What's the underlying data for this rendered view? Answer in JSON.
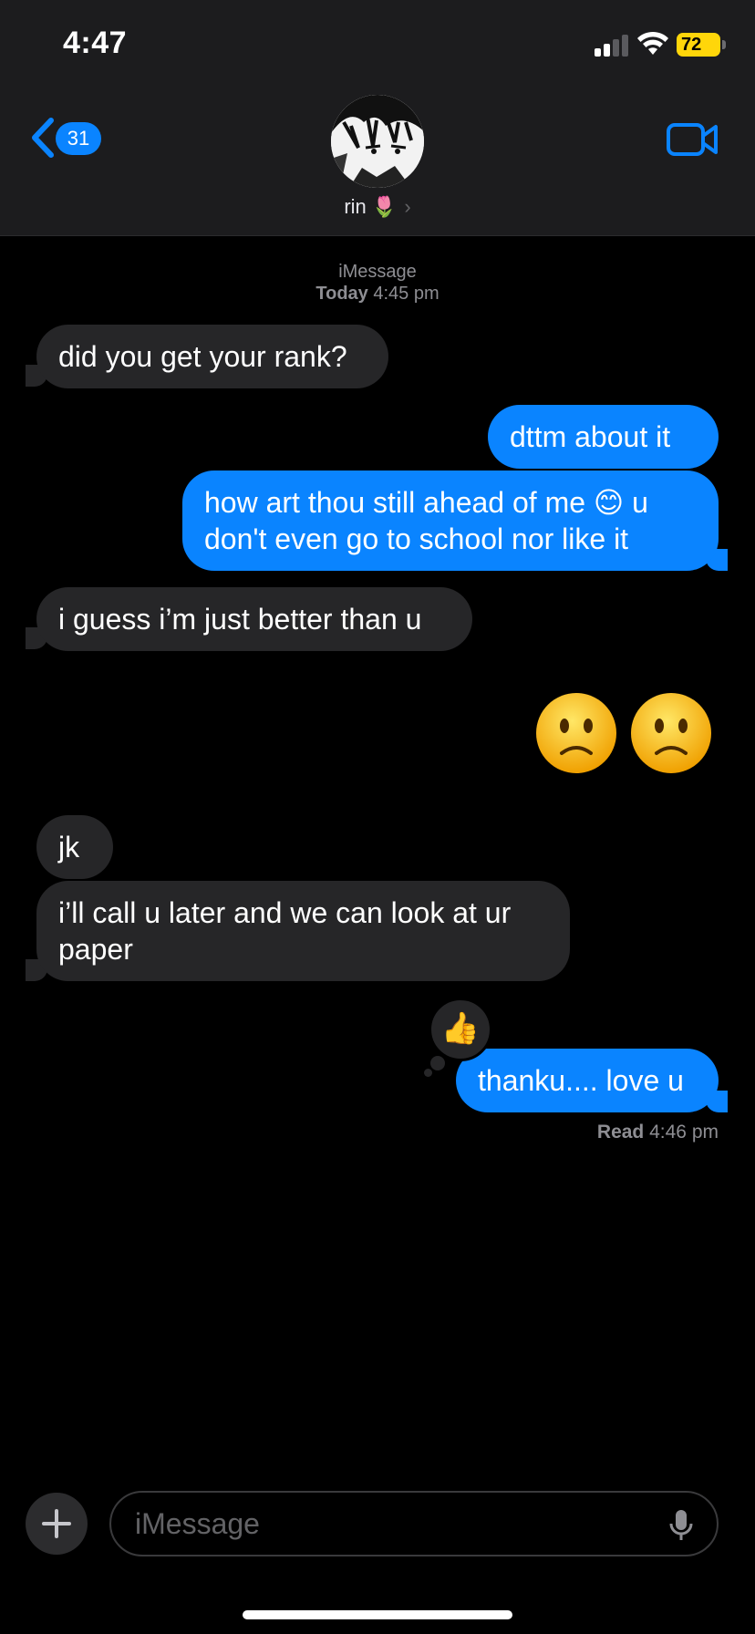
{
  "status_bar": {
    "time": "4:47",
    "battery": "72"
  },
  "nav": {
    "back_count": "31",
    "contact_name": "rin 🌷",
    "chevron": "›"
  },
  "thread": {
    "service": "iMessage",
    "date_day": "Today",
    "date_time": "4:45 pm",
    "messages": [
      {
        "from": "them",
        "text": "did you get your rank?"
      },
      {
        "from": "me",
        "text": "dttm about it"
      },
      {
        "from": "me",
        "text": "how art thou still ahead of me 😊 u don't even go to school nor like it"
      },
      {
        "from": "them",
        "text": "i guess i’m just better than u"
      },
      {
        "from": "me",
        "emoji": "🙁🙁"
      },
      {
        "from": "them",
        "text": "jk"
      },
      {
        "from": "them",
        "text": "i’ll call u later and we can look at ur paper"
      },
      {
        "from": "me",
        "text": "thanku.... love u",
        "tapback": "👍"
      }
    ],
    "read_label": "Read",
    "read_time": "4:46 pm"
  },
  "composer": {
    "placeholder": "iMessage"
  },
  "colors": {
    "outgoing": "#0a84ff",
    "incoming": "#262628",
    "header": "#1c1c1e",
    "battery": "#ffd60a"
  },
  "icons": [
    "back-chevron-icon",
    "video-camera-icon",
    "plus-icon",
    "microphone-icon",
    "signal-icon",
    "wifi-icon",
    "battery-icon"
  ]
}
